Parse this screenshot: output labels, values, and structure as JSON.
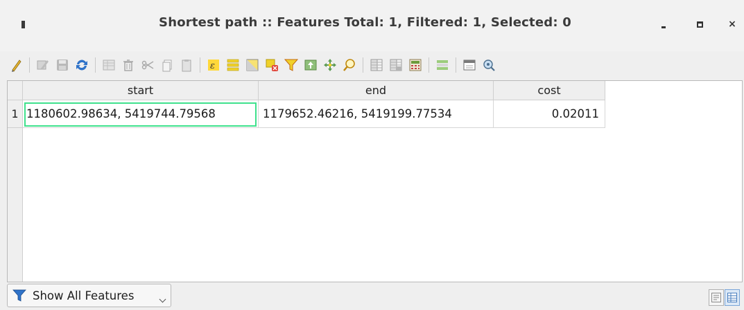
{
  "window": {
    "title": "Shortest path :: Features Total: 1, Filtered: 1, Selected: 0",
    "minimize_icon": "minimize-icon",
    "maximize_icon": "maximize-icon",
    "close_icon": "close-icon",
    "close_glyph": "×"
  },
  "toolbar": {
    "items": [
      {
        "name": "toggle-editing-icon"
      },
      {
        "name": "toggle-multi-edit-icon"
      },
      {
        "name": "save-edits-icon"
      },
      {
        "name": "reload-table-icon"
      },
      {
        "name": "add-feature-icon"
      },
      {
        "name": "delete-selected-icon"
      },
      {
        "name": "cut-icon"
      },
      {
        "name": "copy-icon"
      },
      {
        "name": "paste-icon"
      },
      {
        "name": "expression-select-icon"
      },
      {
        "name": "select-all-icon"
      },
      {
        "name": "invert-selection-icon"
      },
      {
        "name": "deselect-all-icon"
      },
      {
        "name": "filter-select-icon"
      },
      {
        "name": "move-selection-top-icon"
      },
      {
        "name": "pan-to-selected-icon"
      },
      {
        "name": "zoom-to-selected-icon"
      },
      {
        "name": "new-field-icon"
      },
      {
        "name": "delete-field-icon"
      },
      {
        "name": "field-calculator-icon"
      },
      {
        "name": "conditional-formatting-icon"
      },
      {
        "name": "dock-table-icon"
      },
      {
        "name": "actions-icon"
      }
    ]
  },
  "table": {
    "columns": [
      "start",
      "end",
      "cost"
    ],
    "rows": [
      {
        "num": "1",
        "start": "1180602.98634, 5419744.79568",
        "end": "1179652.46216, 5419199.77534",
        "cost": "0.02011"
      }
    ]
  },
  "bottom": {
    "filter_label": "Show All Features",
    "form_view_icon": "form-view-icon",
    "table_view_icon": "table-view-icon"
  },
  "colors": {
    "focus_border": "#3ee18c",
    "title_text": "#3b3b3b"
  }
}
